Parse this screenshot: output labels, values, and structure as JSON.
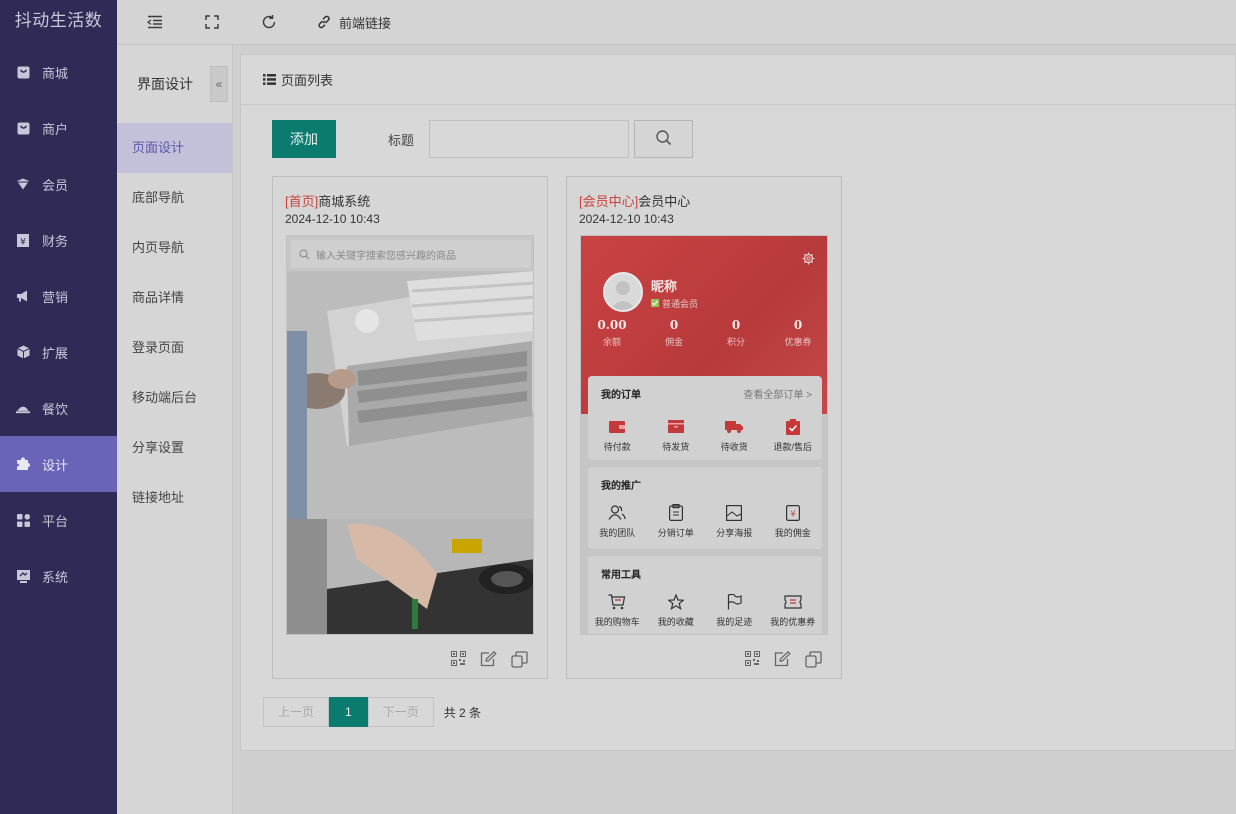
{
  "app": {
    "brand": "抖动生活数"
  },
  "sidebar": {
    "items": [
      {
        "label": "商城",
        "icon": "shop-icon"
      },
      {
        "label": "商户",
        "icon": "merchant-icon"
      },
      {
        "label": "会员",
        "icon": "member-icon"
      },
      {
        "label": "财务",
        "icon": "finance-icon"
      },
      {
        "label": "营销",
        "icon": "megaphone-icon"
      },
      {
        "label": "扩展",
        "icon": "cube-icon"
      },
      {
        "label": "餐饮",
        "icon": "dish-icon"
      },
      {
        "label": "设计",
        "icon": "puzzle-icon",
        "active": true
      },
      {
        "label": "平台",
        "icon": "grid-icon"
      },
      {
        "label": "系统",
        "icon": "system-icon"
      }
    ]
  },
  "topbar": {
    "frontend_link": "前端链接"
  },
  "subnav": {
    "title": "界面设计",
    "collapse": "«",
    "items": [
      "页面设计",
      "底部导航",
      "内页导航",
      "商品详情",
      "登录页面",
      "移动端后台",
      "分享设置",
      "链接地址"
    ]
  },
  "panel": {
    "title": "页面列表",
    "add_label": "添加",
    "title_label": "标题",
    "title_value": ""
  },
  "cards": [
    {
      "tag": "[首页]",
      "name": "商城系统",
      "date": "2024-12-10 10:43",
      "search_placeholder": "输入关键字搜索您感兴趣的商品"
    },
    {
      "tag": "[会员中心]",
      "name": "会员中心",
      "date": "2024-12-10 10:43",
      "member": {
        "nickname": "昵称",
        "level": "普通会员",
        "stats": [
          {
            "value": "0.00",
            "label": "余额"
          },
          {
            "value": "0",
            "label": "佣金"
          },
          {
            "value": "0",
            "label": "积分"
          },
          {
            "value": "0",
            "label": "优惠券"
          }
        ],
        "orders": {
          "title": "我的订单",
          "more": "查看全部订单 >",
          "items": [
            "待付款",
            "待发货",
            "待收货",
            "退款/售后"
          ]
        },
        "promo": {
          "title": "我的推广",
          "items": [
            "我的团队",
            "分销订单",
            "分享海报",
            "我的佣金"
          ]
        },
        "tools": {
          "title": "常用工具",
          "items": [
            "我的购物车",
            "我的收藏",
            "我的足迹",
            "我的优惠券"
          ]
        }
      }
    }
  ],
  "pager": {
    "prev": "上一页",
    "current": "1",
    "next": "下一页",
    "total": "共 2 条"
  }
}
